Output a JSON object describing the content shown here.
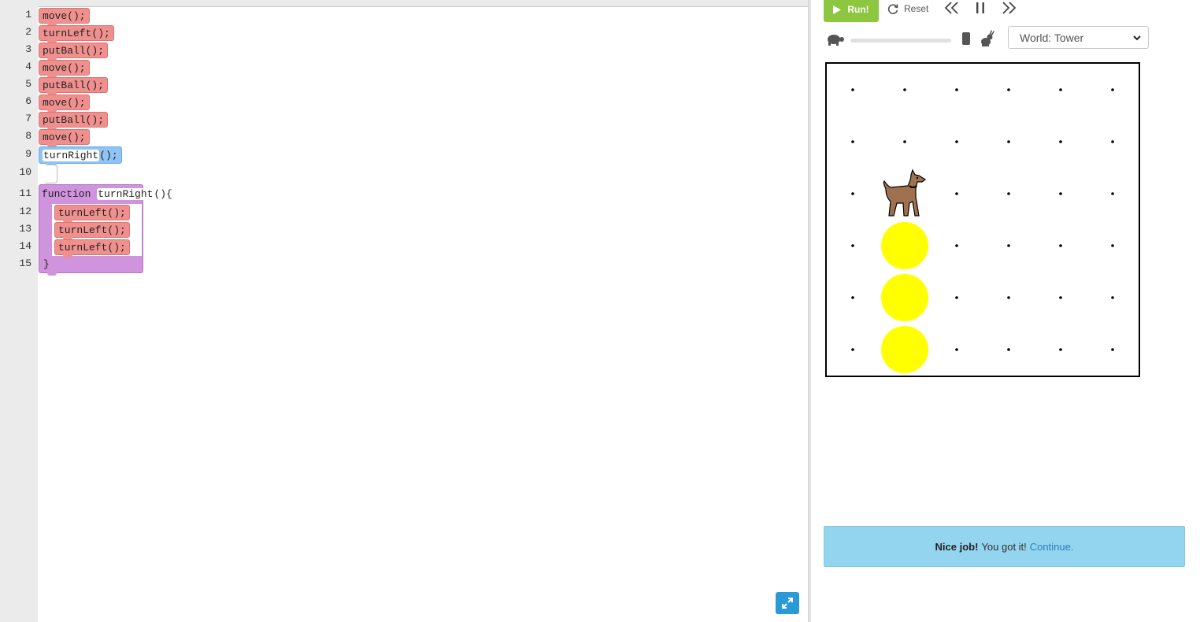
{
  "editor": {
    "line_numbers": [
      "1",
      "2",
      "3",
      "4",
      "5",
      "6",
      "7",
      "8",
      "9",
      "10",
      "11",
      "12",
      "13",
      "14",
      "15"
    ],
    "blocks": [
      "move();",
      "turnLeft();",
      "putBall();",
      "move();",
      "putBall();",
      "move();",
      "putBall();",
      "move();"
    ],
    "call_block": {
      "name": "turnRight",
      "suffix": "();"
    },
    "function_block": {
      "keyword": "function",
      "name": "turnRight",
      "open": "(){",
      "body": [
        "turnLeft();",
        "turnLeft();",
        "turnLeft();"
      ],
      "close": "}"
    }
  },
  "controls": {
    "run_label": "Run!",
    "reset_label": "Reset",
    "world_select": {
      "selected": "World: Tower"
    },
    "speed_level": 1.0
  },
  "world": {
    "cols": 6,
    "rows": 6,
    "karel": {
      "col": 2,
      "row": 3,
      "icon": "dog-icon"
    },
    "balls": [
      {
        "col": 2,
        "row": 4
      },
      {
        "col": 2,
        "row": 5
      },
      {
        "col": 2,
        "row": 6
      }
    ],
    "ball_color": "#ffff00"
  },
  "message": {
    "bold": "Nice job!",
    "text": "You got it!",
    "link": "Continue."
  },
  "colors": {
    "command_block": "#f0908e",
    "call_block": "#8fc4f5",
    "function_block": "#cf94dd",
    "run_button": "#8dc63f",
    "expand_button": "#2a9ad6",
    "message_bg": "#93d4ee"
  }
}
